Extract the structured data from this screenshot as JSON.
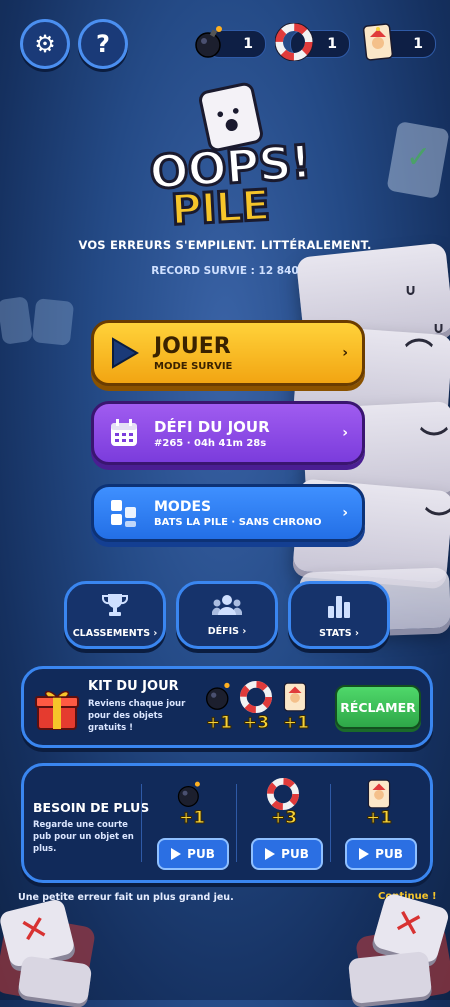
{
  "header": {
    "settings_icon": "gear-icon",
    "help_icon": "question-icon",
    "counters": [
      {
        "icon": "bomb-icon",
        "value": "1"
      },
      {
        "icon": "lifebuoy-icon",
        "value": "1"
      },
      {
        "icon": "joker-card-icon",
        "value": "1"
      }
    ]
  },
  "logo": {
    "line1": "OOPS!",
    "line2": "PILE"
  },
  "tagline": "VOS ERREURS S'EMPILENT. LITTÉRALEMENT.",
  "record": "RECORD SURVIE : 12 840",
  "menu": {
    "play": {
      "title": "JOUER",
      "subtitle": "MODE SURVIE",
      "chevron": "›"
    },
    "daily": {
      "title": "DÉFI DU JOUR",
      "subtitle": "#265 · 04h 41m 28s",
      "chevron": "›"
    },
    "modes": {
      "title": "MODES",
      "subtitle": "BATS LA PILE · SANS CHRONO",
      "chevron": "›"
    }
  },
  "shortcuts": [
    {
      "label": "CLASSEMENTS ›",
      "icon": "trophy-icon"
    },
    {
      "label": "DÉFIS ›",
      "icon": "group-icon"
    },
    {
      "label": "STATS ›",
      "icon": "bar-chart-icon"
    }
  ],
  "daily_kit": {
    "title": "KIT DU JOUR",
    "description": "Reviens chaque jour pour des objets gratuits !",
    "rewards": [
      "+1",
      "+3",
      "+1"
    ],
    "claim_label": "RÉCLAMER"
  },
  "need_more": {
    "title": "BESOIN DE PLUS",
    "description": "Regarde une courte pub pour un objet en plus.",
    "offers": [
      {
        "amount": "+1",
        "button": "PUB"
      },
      {
        "amount": "+3",
        "button": "PUB"
      },
      {
        "amount": "+1",
        "button": "PUB"
      }
    ]
  },
  "footer": {
    "tip": "Une petite erreur fait un plus grand jeu.",
    "continue": "Continue !"
  },
  "colors": {
    "play": "#f2b51c",
    "daily": "#8b47e6",
    "modes": "#2f7ff0",
    "claim": "#3cc25a"
  }
}
